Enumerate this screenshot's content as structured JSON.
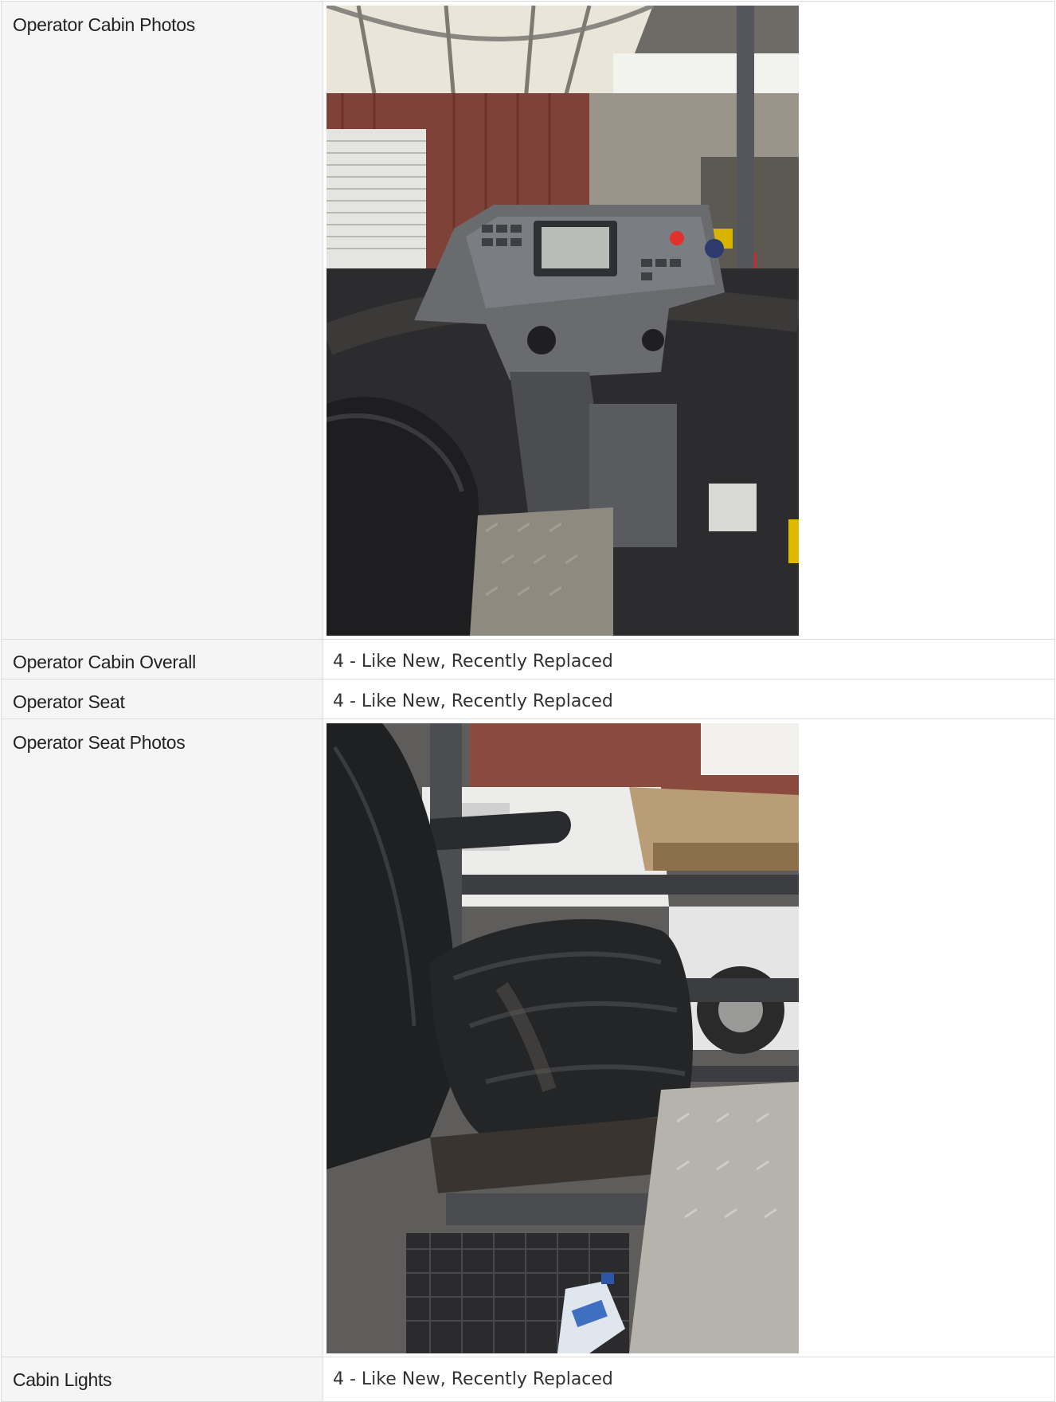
{
  "rows": [
    {
      "label": "Operator Cabin Photos",
      "photo": "operator-cabin-console-photo"
    },
    {
      "label": "Operator Cabin Overall",
      "value": "4 - Like New, Recently Replaced"
    },
    {
      "label": "Operator Seat",
      "value": "4 - Like New, Recently Replaced"
    },
    {
      "label": "Operator Seat Photos",
      "photo": "operator-seat-photo"
    },
    {
      "label": "Cabin Lights",
      "value": "4 - Like New, Recently Replaced"
    }
  ]
}
